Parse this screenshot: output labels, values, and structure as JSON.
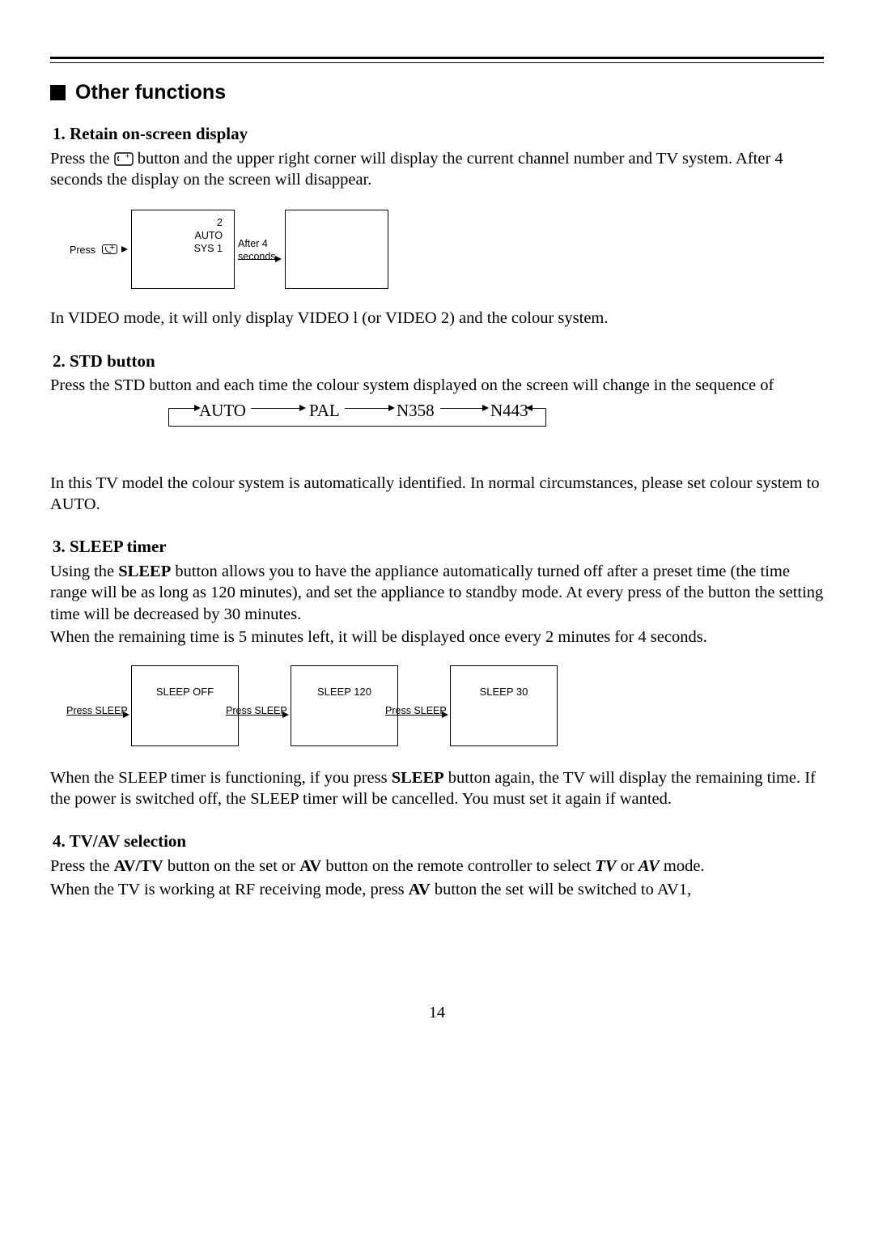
{
  "section_title": "Other functions",
  "s1": {
    "title": "1. Retain on-screen display",
    "para1_pre": "Press the ",
    "para1_post": " button and the upper right corner will display the current channel number and TV system. After 4 seconds the display on the screen will disappear.",
    "press_label": "Press",
    "box_lines": [
      "2",
      "AUTO",
      "SYS 1"
    ],
    "after_label": "After 4\nseconds",
    "para2": "In VIDEO mode, it will only display VIDEO l (or VIDEO 2) and the colour system."
  },
  "s2": {
    "title": "2. STD button",
    "para1": "Press the STD button and each time the colour system displayed on the screen will change in the sequence of",
    "seq": [
      "AUTO",
      "PAL",
      "N358",
      "N443"
    ],
    "para2": "In this TV model the colour system is automatically identified. In normal circumstances, please set colour system to AUTO."
  },
  "s3": {
    "title": "3. SLEEP timer",
    "para1_a": "Using the ",
    "para1_bold": "SLEEP",
    "para1_b": " button allows you to have the appliance automatically turned off after a preset time (the time range will be as long as 120 minutes), and set the appliance to standby mode. At every press of the button the setting time will be decreased by 30 minutes.",
    "para1_c": "When the remaining time is 5 minutes left, it will be displayed once every 2 minutes for 4 seconds.",
    "press_label": "Press SLEEP",
    "boxes": [
      "SLEEP OFF",
      "SLEEP 120",
      "SLEEP 30"
    ],
    "para2": "When the SLEEP timer is functioning, if you press SLEEP button again, the TV will display the remaining time. If the power is switched off, the SLEEP timer will be cancelled. You must set it again if wanted."
  },
  "s4": {
    "title": "4. TV/AV selection",
    "para1": "Press the AV/TV button on the set or AV button on the remote controller to select TV or AV mode.",
    "para2": "When the TV is working at RF receiving mode, press AV button the set will be switched to AV1,"
  },
  "page_number": "14"
}
